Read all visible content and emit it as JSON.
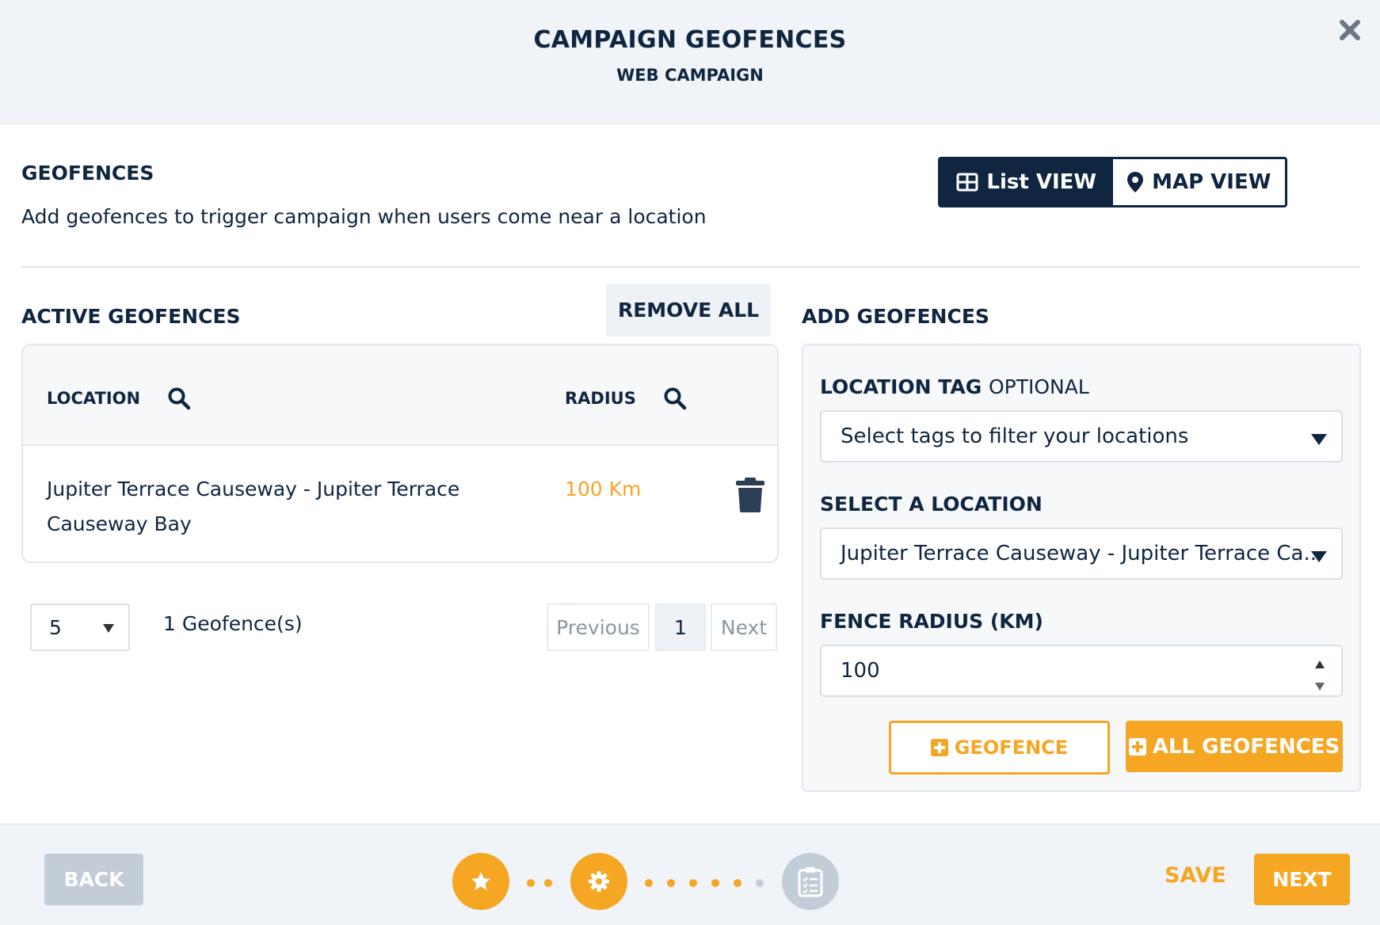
{
  "header": {
    "title": "CAMPAIGN GEOFENCES",
    "subtitle": "WEB CAMPAIGN",
    "close_icon": "close-icon"
  },
  "geofences": {
    "title": "GEOFENCES",
    "description": "Add geofences to trigger campaign when users come near a location",
    "view_toggle": {
      "list_label": "List VIEW",
      "list_icon": "table-icon",
      "map_label": "MAP VIEW",
      "map_icon": "map-pin-icon",
      "active": "list"
    }
  },
  "active_geofences": {
    "title": "ACTIVE GEOFENCES",
    "remove_all_label": "REMOVE ALL",
    "columns": [
      "LOCATION",
      "RADIUS"
    ],
    "rows": [
      {
        "location": "Jupiter Terrace Causeway - Jupiter Terrace Causeway Bay",
        "radius": "100 Km"
      }
    ],
    "page_size": "5",
    "count_label": "1 Geofence(s)",
    "pagination": {
      "previous": "Previous",
      "current": "1",
      "next": "Next"
    }
  },
  "add_geofences": {
    "title": "ADD GEOFENCES",
    "location_tag_label": "LOCATION TAG",
    "location_tag_optional": "OPTIONAL",
    "location_tag_placeholder": "Select tags to filter your locations",
    "select_location_label": "SELECT A LOCATION",
    "select_location_value": "Jupiter Terrace Causeway - Jupiter Terrace Ca...",
    "fence_radius_label": "FENCE RADIUS (KM)",
    "fence_radius_value": "100",
    "add_geofence_label": "GEOFENCE",
    "add_all_label": "ALL GEOFENCES"
  },
  "footer": {
    "back_label": "BACK",
    "save_label": "SAVE",
    "next_label": "NEXT",
    "steps": [
      {
        "icon": "star-icon",
        "state": "done"
      },
      {
        "icon": "gear-icon",
        "state": "done"
      },
      {
        "icon": "clipboard-checklist-icon",
        "state": "todo"
      }
    ]
  },
  "colors": {
    "navy": "#0f2540",
    "accent": "#f5a623",
    "muted": "#c3cdd8",
    "panel": "#f0f3f7"
  }
}
